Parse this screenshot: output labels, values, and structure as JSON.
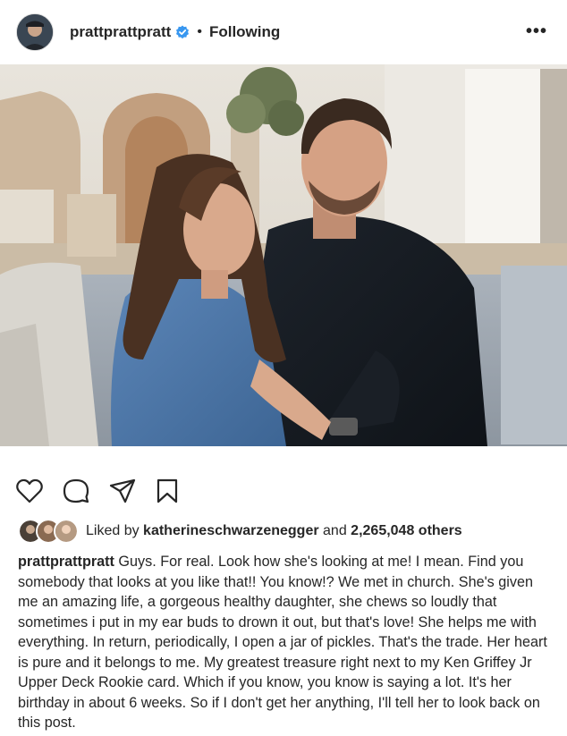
{
  "header": {
    "username": "prattprattpratt",
    "separator": "•",
    "follow_status": "Following",
    "more_label": "•••"
  },
  "colors": {
    "verified_badge": "#3897f0",
    "text": "#262626"
  },
  "icons": {
    "like": "heart-outline-icon",
    "comment": "comment-bubble-icon",
    "share": "paper-plane-icon",
    "save": "bookmark-icon",
    "verified": "verified-badge-icon"
  },
  "likes": {
    "prefix": "Liked by ",
    "user": "katherineschwarzenegger",
    "middle": " and ",
    "count": "2,265,048 others"
  },
  "caption": {
    "username": "prattprattpratt",
    "text": " Guys. For real. Look how she's looking at me! I mean. Find you somebody that looks at you like that!! You know!? We met in church. She's given me an amazing life, a gorgeous healthy daughter, she chews so loudly that sometimes i put in my ear buds to drown it out, but that's love! She helps me with everything. In return, periodically, I open a jar of pickles. That's the trade. Her heart is pure and it belongs to me. My greatest treasure right next to my Ken Griffey Jr Upper Deck Rookie card. Which if you know, you know is saying a lot. It's her birthday in about 6 weeks. So if I don't get her anything, I'll tell her to look back on this post."
  }
}
